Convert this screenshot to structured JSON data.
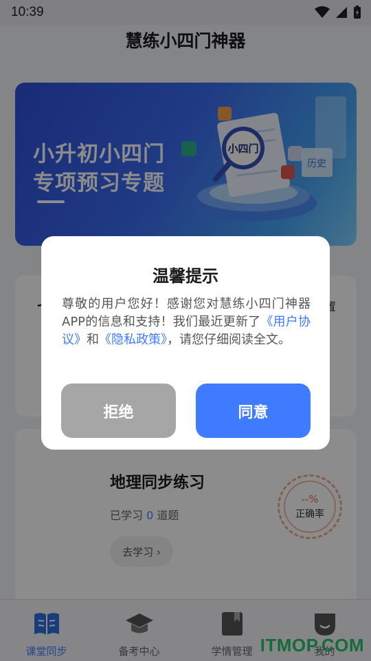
{
  "status_bar": {
    "time": "10:39"
  },
  "header": {
    "title": "慧练小四门神器"
  },
  "banner": {
    "line1": "小升初小四门",
    "line2": "专项预习专题",
    "magnifier_text": "小四门",
    "tile_text": "历史"
  },
  "cards": {
    "first": {
      "partial_left": "七",
      "partial_right": "置"
    },
    "subject": {
      "title": "地理同步练习",
      "learned_prefix": "已学习 ",
      "learned_count": "0",
      "learned_suffix": " 道题",
      "go_study": "去学习 ›",
      "accuracy_value": "--%",
      "accuracy_label": "正确率"
    }
  },
  "bottom_nav": {
    "items": [
      {
        "label": "课堂同步",
        "icon": "book-open-icon",
        "active": true
      },
      {
        "label": "备考中心",
        "icon": "graduation-cap-icon",
        "active": false
      },
      {
        "label": "学情管理",
        "icon": "notebook-icon",
        "active": false
      },
      {
        "label": "我的",
        "icon": "profile-icon",
        "active": false
      }
    ]
  },
  "watermark": "ITMOP.COM",
  "dialog": {
    "title": "温馨提示",
    "body_part1": "尊敬的用户您好！感谢您对慧练小四门神器APP的信息和支持！我们最近更新了",
    "link_agreement": "《用户协议》",
    "and_text": "和",
    "link_privacy": "《隐私政策》",
    "body_part2": "，请您仔细阅读全文。",
    "reject_label": "拒绝",
    "agree_label": "同意"
  },
  "colors": {
    "accent": "#3e7bff",
    "reject_button": "#a6a6a6",
    "accuracy_ring": "#f3a88f",
    "watermark": "#27c46b"
  }
}
